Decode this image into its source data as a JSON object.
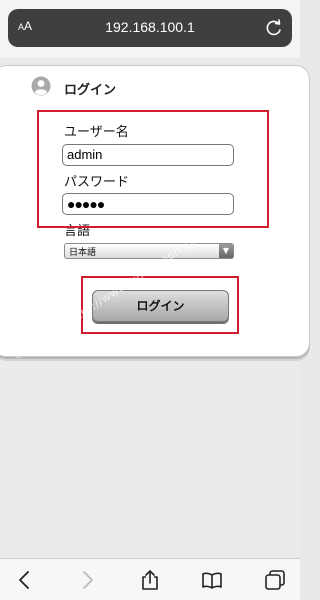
{
  "browser": {
    "text_size_label": "AA",
    "url": "192.168.100.1"
  },
  "login": {
    "title": "ログイン",
    "username_label": "ユーザー名",
    "username_value": "admin",
    "password_label": "パスワード",
    "password_value_masked": "●●●●●",
    "language_label": "言語",
    "language_selected": "日本語",
    "login_button_label": "ログイン"
  },
  "watermark": "©Wi-Fiの森 http://www.wifinomori.com",
  "icons": {
    "text_size": "text-size-icon",
    "reload": "reload-icon",
    "user": "user-icon",
    "back": "back-icon",
    "forward": "forward-icon",
    "share": "share-icon",
    "bookmarks": "bookmarks-icon",
    "tabs": "tabs-icon"
  },
  "colors": {
    "highlight_box": "#d01e2e",
    "urlbar": "#3f3f3f",
    "button_gradient_top": "#dedede",
    "button_gradient_bottom": "#a7a7a7"
  }
}
